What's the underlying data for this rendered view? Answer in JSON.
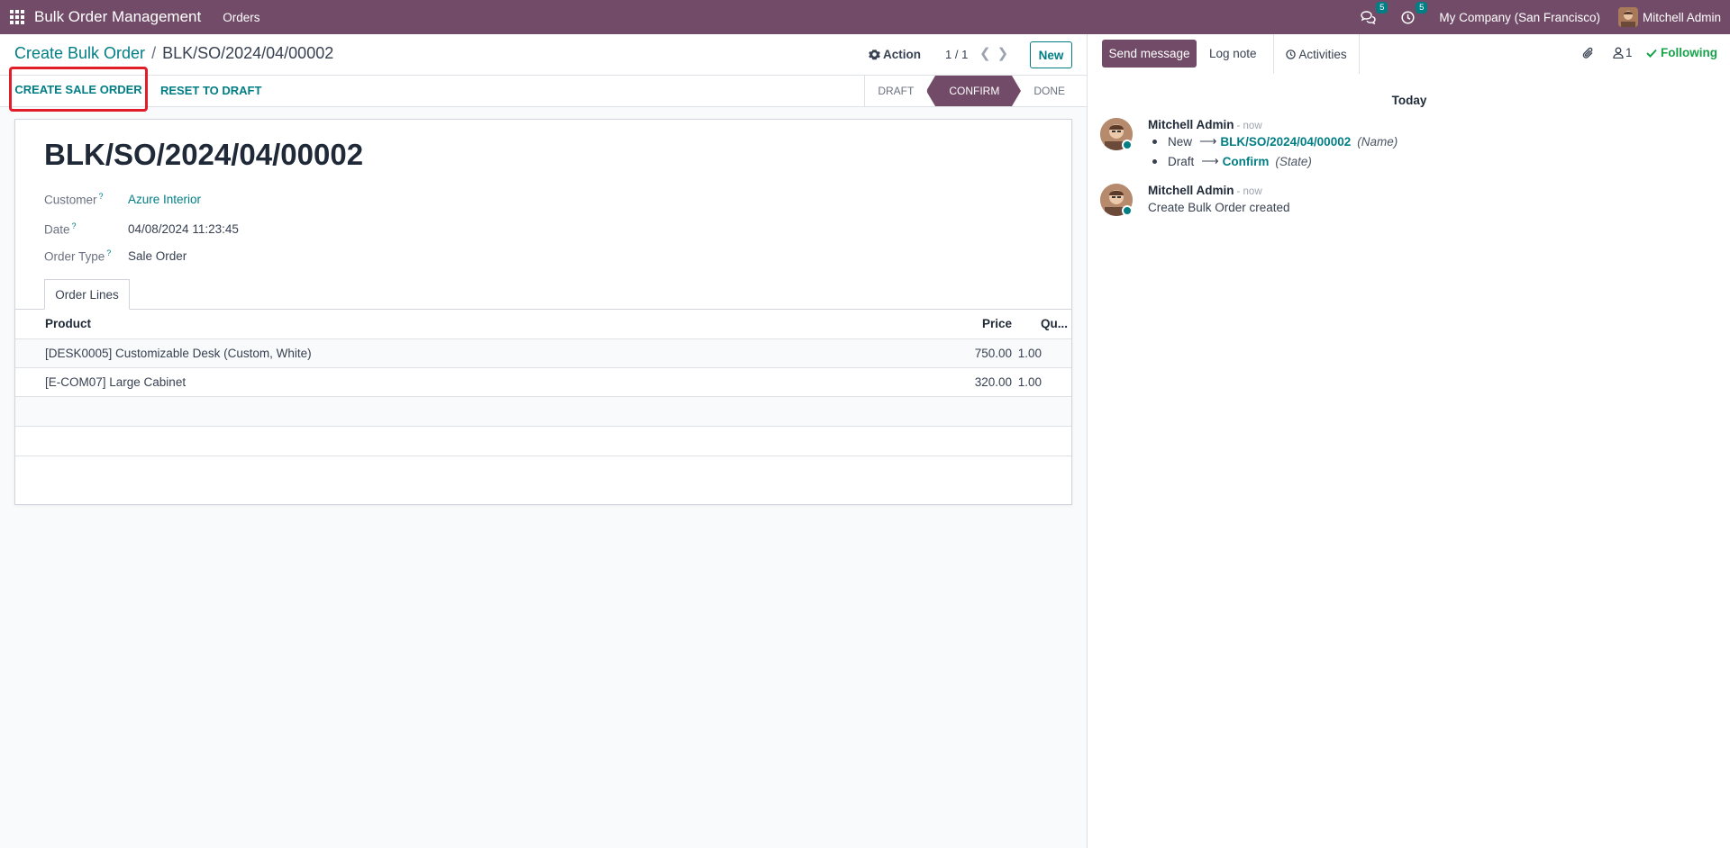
{
  "navbar": {
    "app_name": "Bulk Order Management",
    "menu_orders": "Orders",
    "messages_count": "5",
    "activities_count": "5",
    "company": "My Company (San Francisco)",
    "user": "Mitchell Admin"
  },
  "control_panel": {
    "breadcrumb_parent": "Create Bulk Order",
    "breadcrumb_separator": "/",
    "breadcrumb_current": "BLK/SO/2024/04/00002",
    "action_label": "Action",
    "pager": "1 / 1",
    "new_label": "New"
  },
  "status_bar": {
    "create_sale_order": "CREATE SALE ORDER",
    "reset_to_draft": "RESET TO DRAFT",
    "stages": [
      "DRAFT",
      "CONFIRM",
      "DONE"
    ],
    "active_stage": "CONFIRM"
  },
  "form": {
    "title": "BLK/SO/2024/04/00002",
    "customer_label": "Customer",
    "customer_value": "Azure Interior",
    "date_label": "Date",
    "date_value": "04/08/2024 11:23:45",
    "order_type_label": "Order Type",
    "order_type_value": "Sale Order",
    "help_marker": "?",
    "tab_label": "Order Lines",
    "columns": {
      "product": "Product",
      "price": "Price",
      "qty": "Qu..."
    },
    "lines": [
      {
        "product": "[DESK0005] Customizable Desk (Custom, White)",
        "price": "750.00",
        "qty": "1.00"
      },
      {
        "product": "[E-COM07] Large Cabinet",
        "price": "320.00",
        "qty": "1.00"
      }
    ]
  },
  "chatter": {
    "send_message": "Send message",
    "log_note": "Log note",
    "activities": "Activities",
    "followers_count": "1",
    "following": "Following",
    "date_separator": "Today",
    "messages": [
      {
        "author": "Mitchell Admin",
        "time": "- now",
        "tracking": [
          {
            "old": "New",
            "new": "BLK/SO/2024/04/00002",
            "field": "(Name)"
          },
          {
            "old": "Draft",
            "new": "Confirm",
            "field": "(State)"
          }
        ]
      },
      {
        "author": "Mitchell Admin",
        "time": "- now",
        "body": "Create Bulk Order created"
      }
    ]
  },
  "colors": {
    "brand": "#714b67",
    "link": "#017e84",
    "highlight_box": "#e11d2a",
    "following": "#16a34a"
  }
}
